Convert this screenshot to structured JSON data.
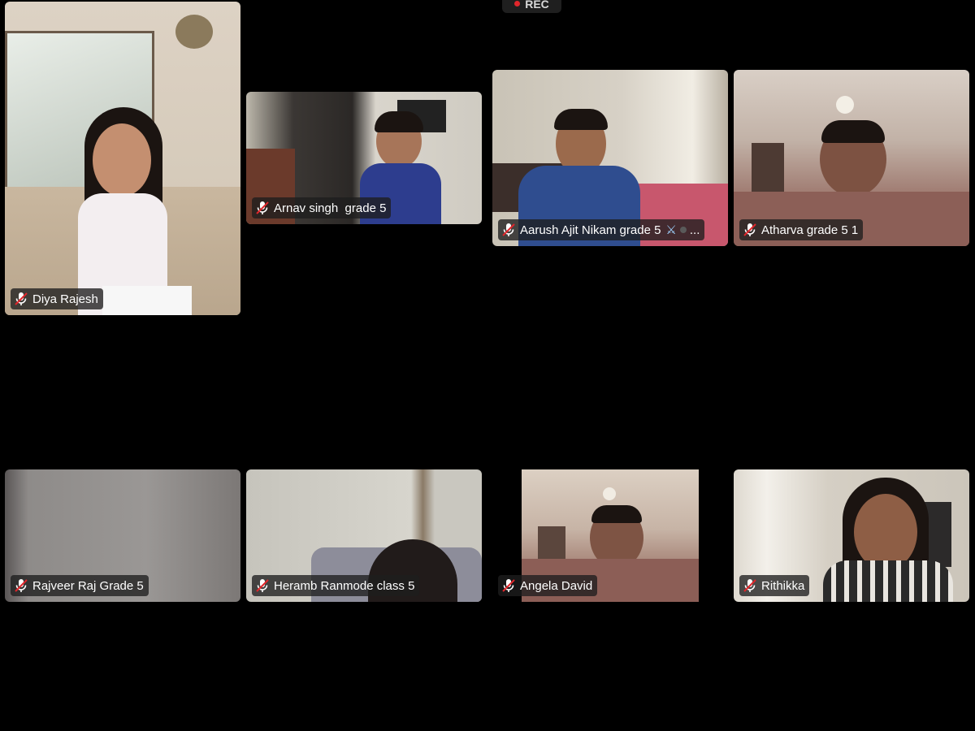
{
  "recording": {
    "label": "REC",
    "color": "#e0262b"
  },
  "participants": [
    {
      "name": "Diya Rajesh",
      "muted": true
    },
    {
      "name": "Arnav singh  grade 5",
      "muted": true
    },
    {
      "name": "Aarush Ajit Nikam grade 5",
      "muted": true,
      "badge_icon": "crossed-swords-icon",
      "overflow": "..."
    },
    {
      "name": "Atharva grade 5 1",
      "muted": true
    },
    {
      "name": "Rajveer Raj Grade 5",
      "muted": true
    },
    {
      "name": "Heramb Ranmode class 5",
      "muted": true
    },
    {
      "name": "Angela David",
      "muted": true
    },
    {
      "name": "Rithikka",
      "muted": true
    }
  ],
  "icons": {
    "mic_muted": "mic-muted-icon"
  },
  "colors": {
    "background": "#000000",
    "label_bg": "#1e1e1e",
    "muted_slash": "#e0262b"
  }
}
